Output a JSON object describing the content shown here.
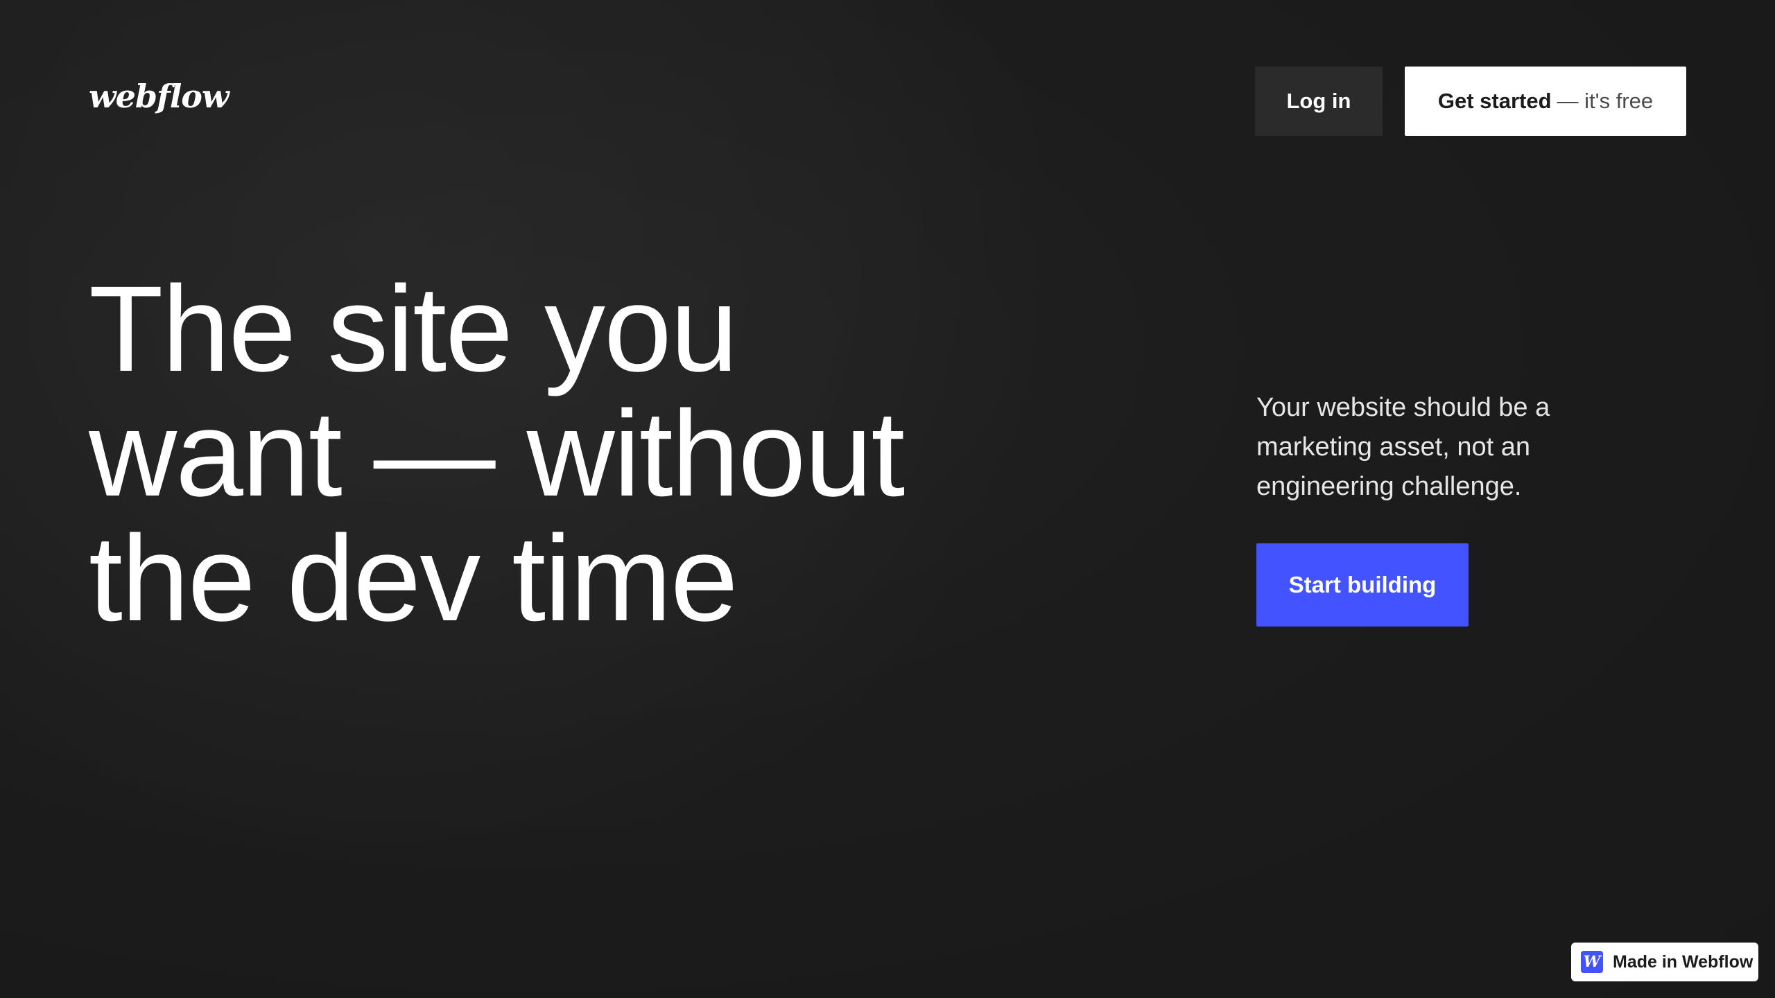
{
  "header": {
    "logo_text": "webflow",
    "login_label": "Log in",
    "get_started_strong": "Get started",
    "get_started_suffix": "— it's free"
  },
  "hero": {
    "headline_lines": [
      "The site you",
      "want — without",
      "the dev time"
    ],
    "subtext": "Your website should be a marketing asset, not an engineering challenge.",
    "cta_label": "Start building"
  },
  "badge": {
    "icon_letter": "W",
    "label": "Made in Webflow"
  },
  "colors": {
    "background": "#1b1b1b",
    "accent": "#4353ff",
    "button_dark": "#2b2b2b",
    "button_light": "#ffffff"
  },
  "icons": {
    "badge_icon": "webflow-w-icon"
  }
}
